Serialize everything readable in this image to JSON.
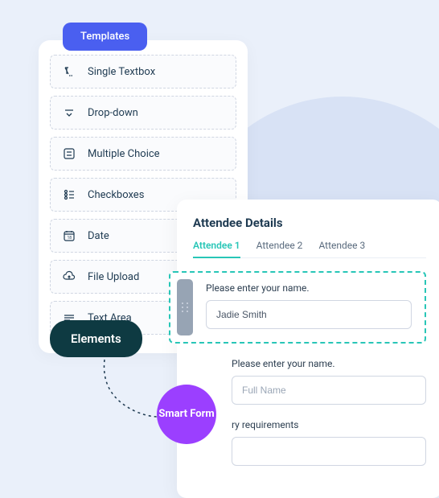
{
  "templates": {
    "tab_label": "Templates",
    "badge_label": "Elements",
    "items": [
      {
        "label": "Single Textbox"
      },
      {
        "label": "Drop-down"
      },
      {
        "label": "Multiple Choice"
      },
      {
        "label": "Checkboxes"
      },
      {
        "label": "Date"
      },
      {
        "label": "File Upload"
      },
      {
        "label": "Text Area"
      }
    ]
  },
  "smart_form_label": "Smart Form",
  "details": {
    "title": "Attendee Details",
    "tabs": [
      {
        "label": "Attendee 1"
      },
      {
        "label": "Attendee 2"
      },
      {
        "label": "Attendee 3"
      }
    ],
    "dropzone": {
      "prompt": "Please enter your name.",
      "value": "Jadie Smith"
    },
    "fields": [
      {
        "label": "Please enter your name.",
        "placeholder": "Full Name"
      },
      {
        "label": "ry requirements",
        "placeholder": ""
      }
    ]
  },
  "colors": {
    "accent": "#4a5ff0",
    "teal": "#28c6b7",
    "purple": "#9b3fff",
    "dark": "#0e3a42"
  }
}
